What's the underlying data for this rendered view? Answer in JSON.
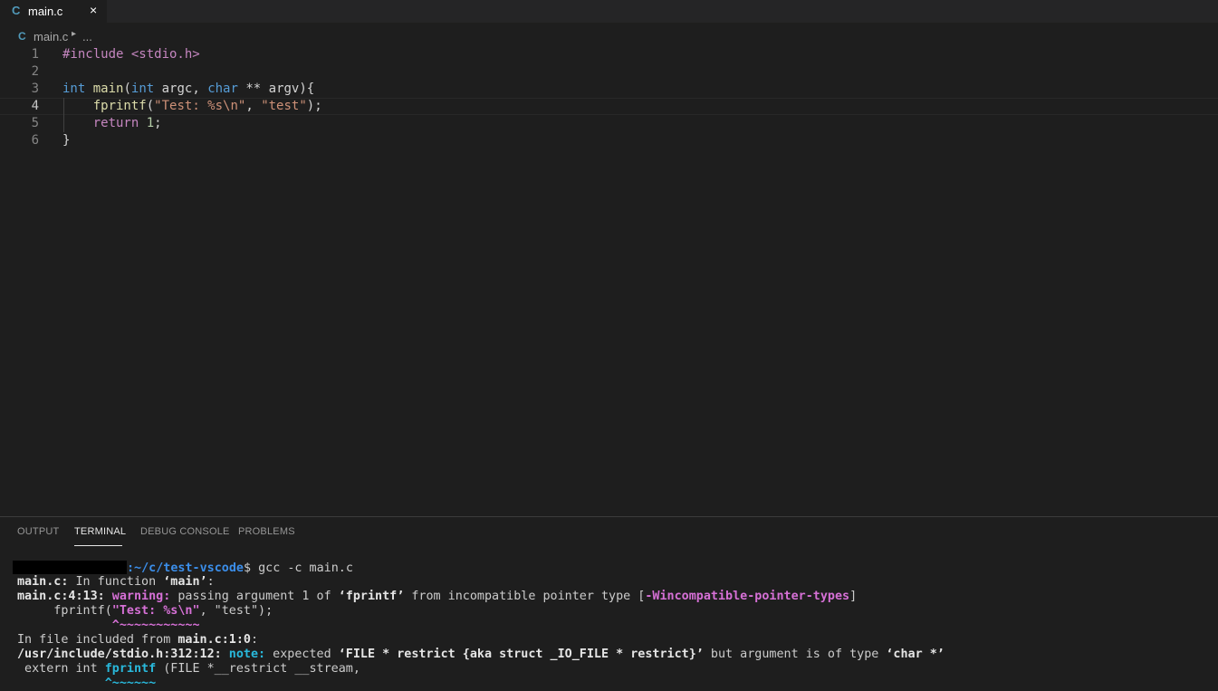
{
  "tab": {
    "icon": "C",
    "label": "main.c",
    "close": "×"
  },
  "breadcrumb": {
    "icon": "C",
    "file": "main.c",
    "sep": "▸",
    "more": "..."
  },
  "editor": {
    "lines": [
      {
        "num": "1",
        "parts": [
          {
            "t": "#include <stdio.h>",
            "c": "pp"
          }
        ]
      },
      {
        "num": "2",
        "parts": []
      },
      {
        "num": "3",
        "parts": [
          {
            "t": "int",
            "c": "kw"
          },
          {
            "t": " ",
            "c": "plain"
          },
          {
            "t": "main",
            "c": "fn"
          },
          {
            "t": "(",
            "c": "plain"
          },
          {
            "t": "int",
            "c": "kw"
          },
          {
            "t": " argc, ",
            "c": "plain"
          },
          {
            "t": "char",
            "c": "kw"
          },
          {
            "t": " ** argv){",
            "c": "plain"
          }
        ]
      },
      {
        "num": "4",
        "parts": [
          {
            "t": "    ",
            "c": "plain"
          },
          {
            "t": "fprintf",
            "c": "fn"
          },
          {
            "t": "(",
            "c": "plain"
          },
          {
            "t": "\"Test: %s\\n\"",
            "c": "str"
          },
          {
            "t": ", ",
            "c": "plain"
          },
          {
            "t": "\"test\"",
            "c": "str"
          },
          {
            "t": ");",
            "c": "plain"
          }
        ]
      },
      {
        "num": "5",
        "parts": [
          {
            "t": "    ",
            "c": "plain"
          },
          {
            "t": "return",
            "c": "pp"
          },
          {
            "t": " ",
            "c": "plain"
          },
          {
            "t": "1",
            "c": "num"
          },
          {
            "t": ";",
            "c": "plain"
          }
        ]
      },
      {
        "num": "6",
        "parts": [
          {
            "t": "}",
            "c": "plain"
          }
        ]
      }
    ]
  },
  "panel": {
    "tabs": [
      {
        "label": "OUTPUT"
      },
      {
        "label": "TERMINAL"
      },
      {
        "label": "DEBUG CONSOLE"
      },
      {
        "label": "PROBLEMS"
      }
    ]
  },
  "terminal": {
    "prompt_path": ":~/c/test-vscode",
    "prompt_cmd": "$ gcc -c main.c",
    "l2_a": "main.c:",
    "l2_b": " In function ",
    "l2_c": "‘main’",
    "l2_d": ":",
    "l3_loc": "main.c:4:13:",
    "l3_warn": " warning:",
    "l3_a": " passing argument 1 of ",
    "l3_fn": "‘fprintf’",
    "l3_b": " from incompatible pointer type [",
    "l3_flag": "-Wincompatible-pointer-types",
    "l3_c": "]",
    "l4_a": "     fprintf(",
    "l4_str": "\"Test: %s\\n\"",
    "l4_b": ", \"test\");",
    "l5_caret": "             ^~~~~~~~~~~~",
    "l6_a": "In file included from ",
    "l6_b": "main.c:1:0",
    "l6_c": ":",
    "l7_loc": "/usr/include/stdio.h:312:12:",
    "l7_note": " note:",
    "l7_a": " expected ",
    "l7_t1": "‘FILE * restrict {aka struct _IO_FILE * restrict}’",
    "l7_b": " but argument is of type ",
    "l7_t2": "‘char *’",
    "l8_a": " extern int ",
    "l8_fn": "fprintf",
    "l8_b": " (FILE *__restrict __stream,",
    "l9_caret": "            ^~~~~~~"
  }
}
